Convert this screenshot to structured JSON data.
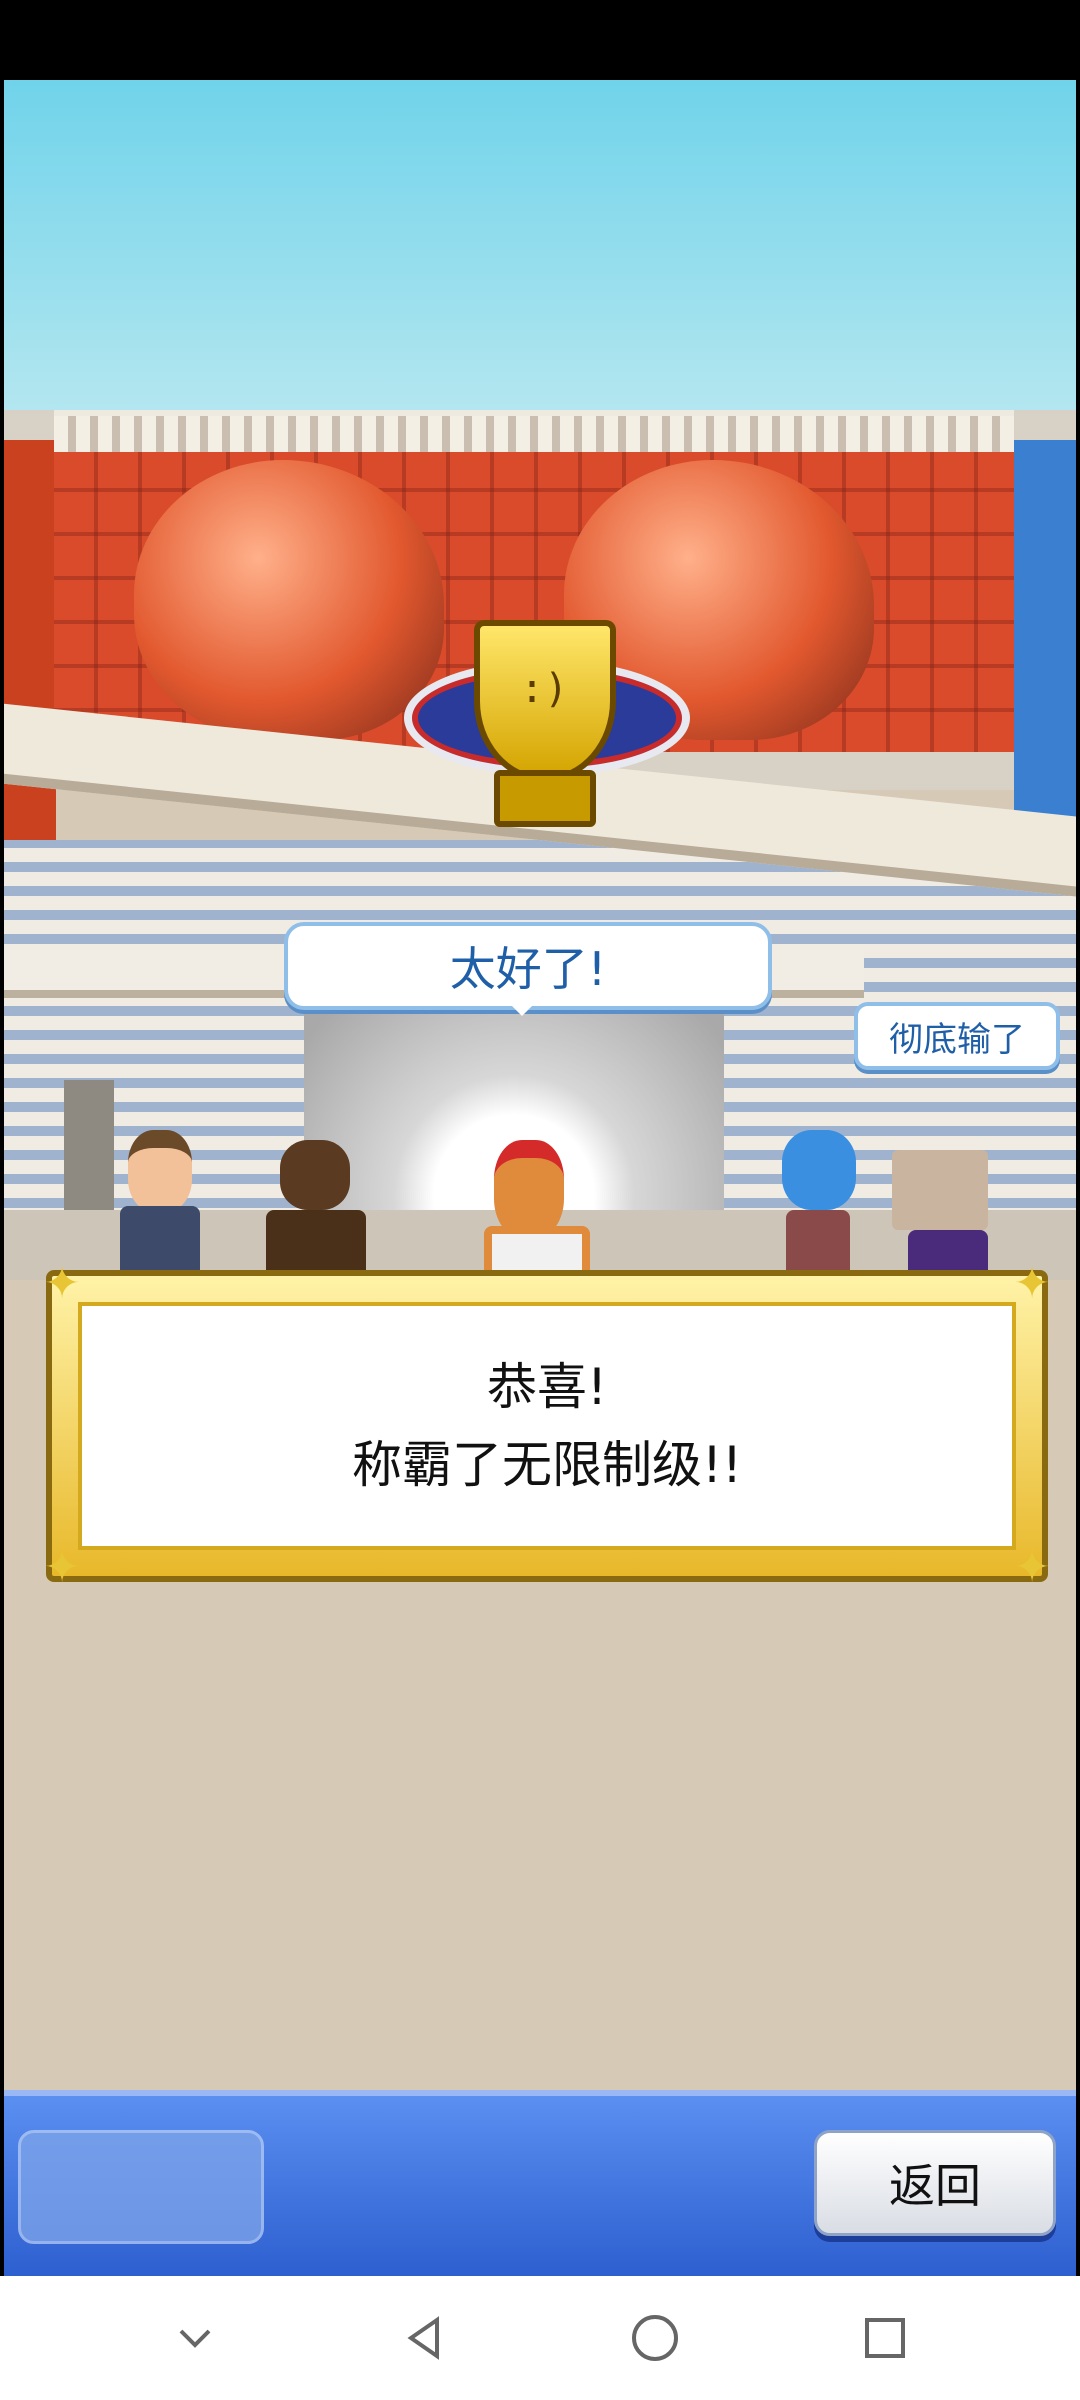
{
  "scene": {
    "shout_main": "太好了!",
    "shout_side": "彻底输了"
  },
  "dialog": {
    "line1": "恭喜!",
    "line2": "称霸了无限制级!!"
  },
  "bottom_bar": {
    "back_label": "返回"
  },
  "navbar": {
    "icons": [
      "chevron-down-icon",
      "back-triangle-icon",
      "home-circle-icon",
      "recents-square-icon"
    ]
  },
  "colors": {
    "sky": "#70d3ea",
    "bar_blue": "#2e5fd0",
    "dialog_gold": "#e8b82a"
  }
}
